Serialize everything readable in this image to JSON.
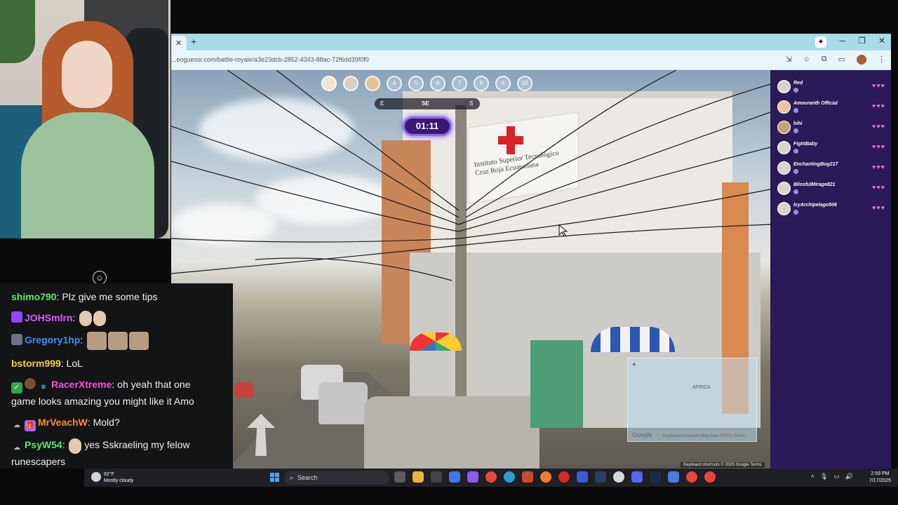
{
  "browser": {
    "url": "...eoguessr.com/battle-royale/a3e23dcb-2852-4343-88ac-72f6dd39f0f0",
    "tab_close": "✕",
    "new_tab": "+"
  },
  "game": {
    "player_slots": [
      "4",
      "5",
      "6",
      "7",
      "8",
      "9",
      "10"
    ],
    "compass": {
      "left": "E",
      "center": "SE",
      "right": "S"
    },
    "timer": "01:11",
    "minimap_label": "AFRICA",
    "minimap_google": "Google",
    "minimap_footer": "Keyboard shortcuts   Map Data ©2025   Terms",
    "streetview_footer": "Keyboard shortcuts  © 2025 Google  Terms",
    "sign_text": "Instituto Superior Tecnológico Cruz Roja Ecuatoriana"
  },
  "players": [
    {
      "name": "Red",
      "hearts": "♥♥♥"
    },
    {
      "name": "Amouranth Official",
      "hearts": "♥♥♥"
    },
    {
      "name": "hihi",
      "hearts": "♥♥♥"
    },
    {
      "name": "FightBaby",
      "hearts": "♥♥♥"
    },
    {
      "name": "EnchantingBog217",
      "hearts": "♥♥♥"
    },
    {
      "name": "BlissfulMirage821",
      "hearts": "♥♥♥"
    },
    {
      "name": "IcyArchipelago506",
      "hearts": "♥♥♥"
    }
  ],
  "chat": [
    {
      "user": "shimo790",
      "color": "#5ce86c",
      "text": "Plz give me some tips"
    },
    {
      "user": "JOHSmlrn",
      "color": "#d65cff",
      "text": ""
    },
    {
      "user": "Gregory1hp",
      "color": "#3b8df0",
      "text": ""
    },
    {
      "user": "bstorm999",
      "color": "#f5d33a",
      "text": "LoL"
    },
    {
      "user": "RacerXtreme",
      "color": "#ff4fd8",
      "text": "oh yeah that one"
    },
    {
      "user": "",
      "color": "#efeff1",
      "text": "game looks amazing you might like it Amo"
    },
    {
      "user": "MrVeachW",
      "color": "#ff8a2b",
      "text": "Mold?"
    },
    {
      "user": "PsyW54",
      "color": "#5ce86c",
      "text": "yes Sskraeling my felow"
    },
    {
      "user": "",
      "color": "#efeff1",
      "text": "runescapers"
    }
  ],
  "taskbar": {
    "temperature": "92°F",
    "weather": "Mostly cloudy",
    "search_label": "Search",
    "time": "2:59 PM",
    "date": "7/17/2025"
  },
  "colors": {
    "sidebar_bg": "#2a1a57",
    "timer_border": "#8e6bf2",
    "heart": "#e46fe0"
  }
}
